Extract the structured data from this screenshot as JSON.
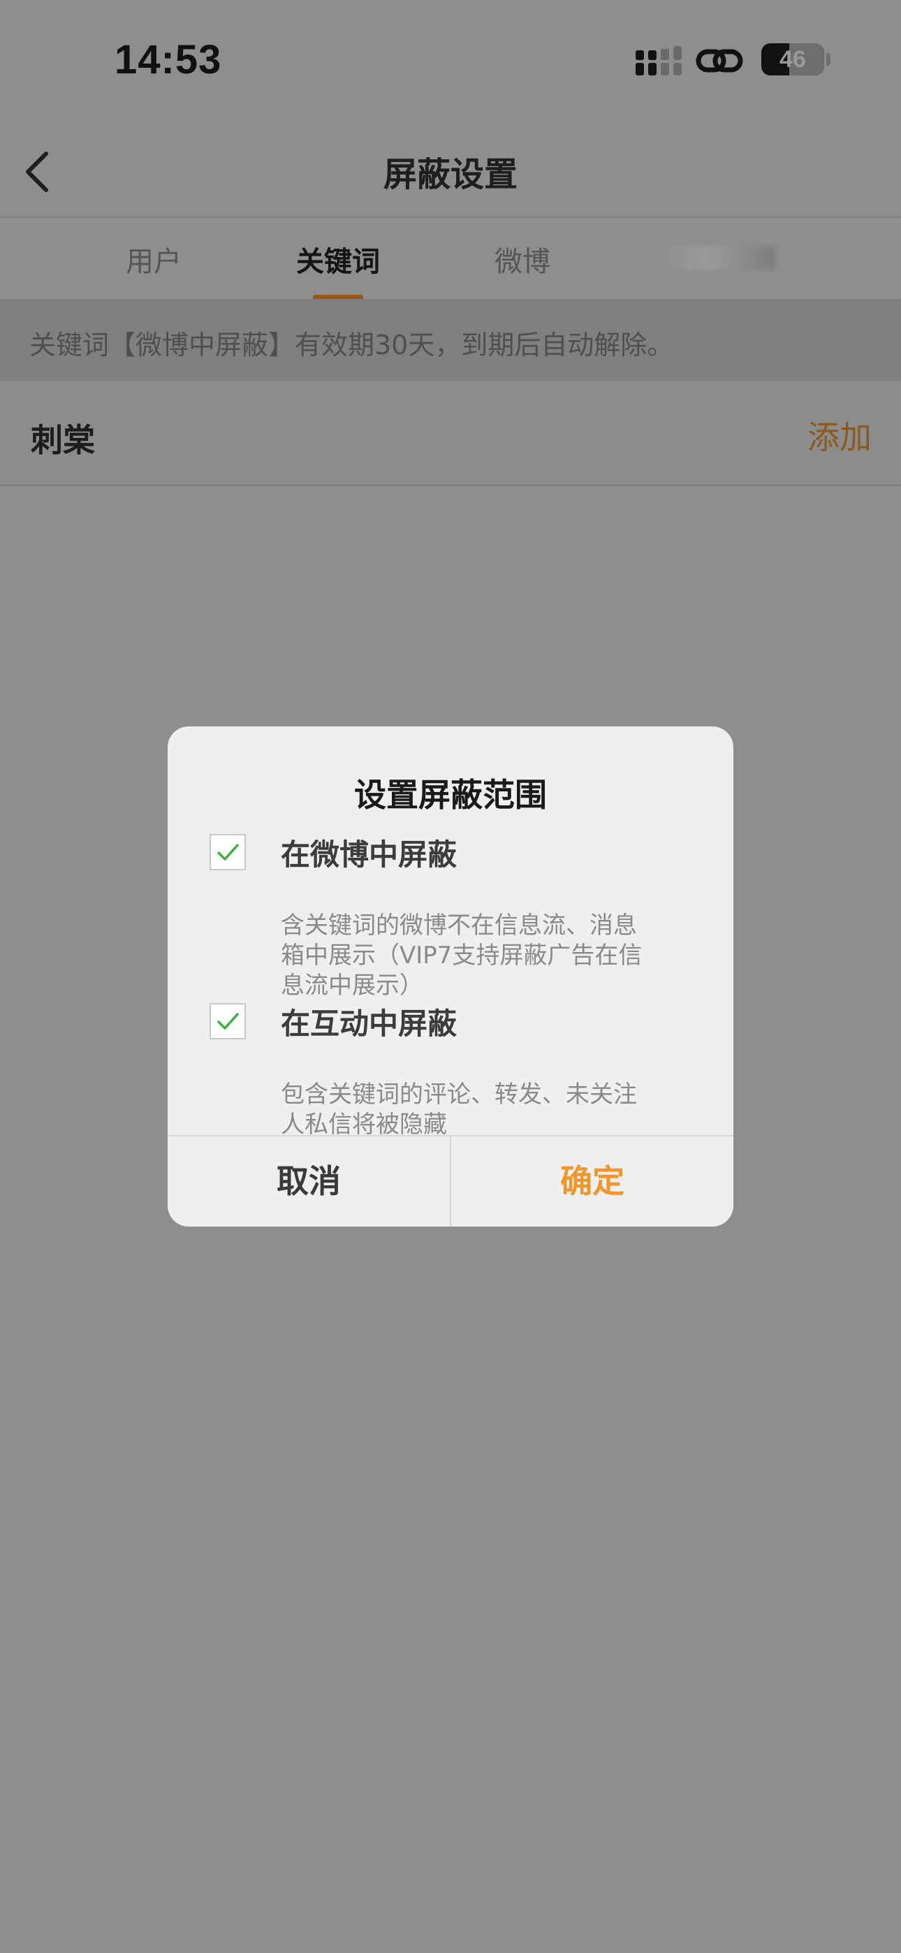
{
  "status": {
    "time": "14:53",
    "battery": "46"
  },
  "nav": {
    "title": "屏蔽设置"
  },
  "tabs": [
    {
      "label": "用户"
    },
    {
      "label": "关键词"
    },
    {
      "label": "微博"
    }
  ],
  "notice": "关键词【微博中屏蔽】有效期30天，到期后自动解除。",
  "keyword_row": {
    "keyword": "刺棠",
    "add_label": "添加"
  },
  "dialog": {
    "title": "设置屏蔽范围",
    "options": [
      {
        "label": "在微博中屏蔽",
        "checked": true,
        "desc": [
          "含关键词的微博不在信息流、消息",
          "箱中展示（VIP7支持屏蔽广告在信",
          "息流中展示）"
        ]
      },
      {
        "label": "在互动中屏蔽",
        "checked": true,
        "desc": [
          "包含关键词的评论、转发、未关注",
          "人私信将被隐藏"
        ]
      }
    ],
    "cancel_label": "取消",
    "ok_label": "确定"
  },
  "colors": {
    "accent": "#f0962b",
    "add": "#8c5a1c",
    "check": "#3cb043",
    "overlay": "#8e8e8e"
  }
}
